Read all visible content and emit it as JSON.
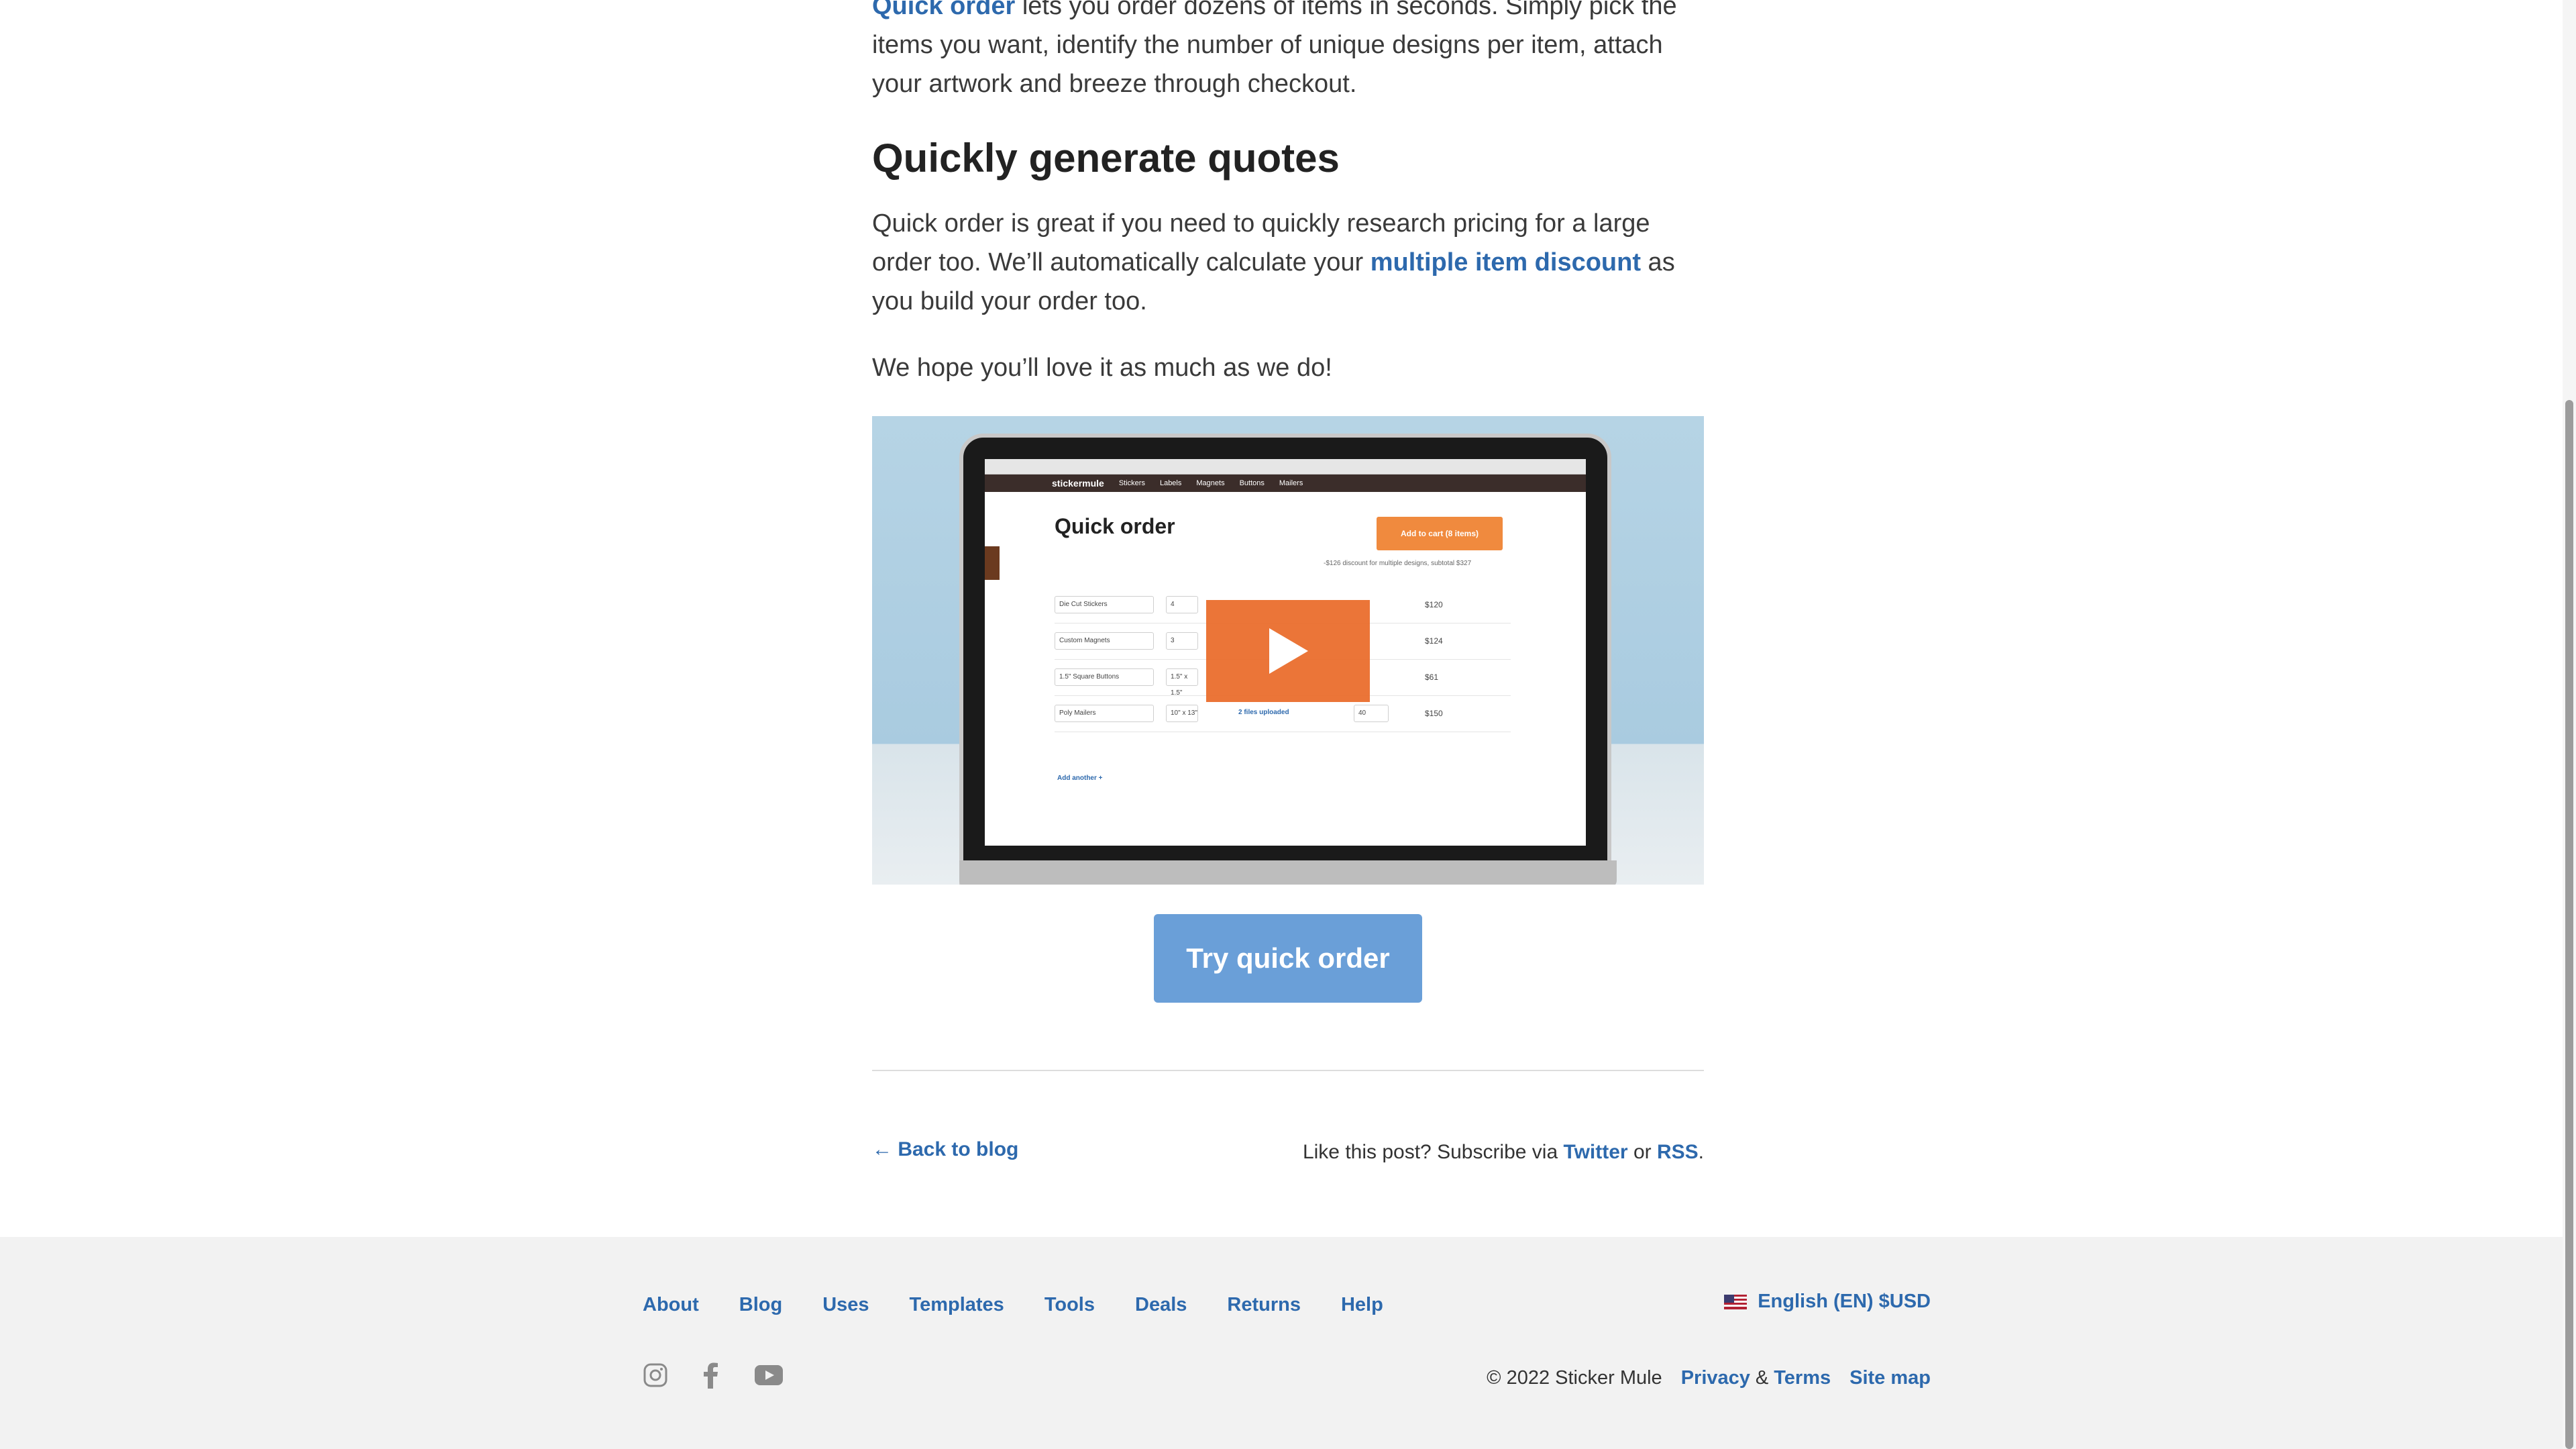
{
  "article": {
    "intro_link": "Quick order",
    "intro_text": " lets you order dozens of items in seconds. Simply pick the items you want, identify the number of unique designs per item, attach your artwork and breeze through checkout.",
    "quotes_heading": "Quickly generate quotes",
    "quotes_text_1": "Quick order is great if you need to quickly research pricing for a large order too. We’ll automatically calculate your ",
    "quotes_link": "multiple item discount",
    "quotes_text_2": " as you build your order too.",
    "hope_text": "We hope you’ll love it as much as we do!"
  },
  "video": {
    "site_logo": "stickermule",
    "nav_items": [
      "Stickers",
      "Labels",
      "Magnets",
      "Buttons",
      "Mailers"
    ],
    "screen_title": "Quick order",
    "cart_button": "Add to cart (8 items)",
    "discount_note": "-$126 discount for multiple designs, subtotal $327",
    "rows": [
      {
        "product": "Die Cut Stickers",
        "size": "4",
        "qty": "",
        "price": "$120",
        "uploaded": ""
      },
      {
        "product": "Custom Magnets",
        "size": "3",
        "qty": "",
        "price": "$124",
        "uploaded": ""
      },
      {
        "product": "1.5\" Square Buttons",
        "size": "1.5\" x 1.5\"",
        "qty": "",
        "price": "$61",
        "uploaded": ""
      },
      {
        "product": "Poly Mailers",
        "size": "10\" x 13\"",
        "qty": "40",
        "price": "$150",
        "uploaded": "2 files uploaded"
      }
    ],
    "add_another": "Add another +"
  },
  "cta": {
    "label": "Try quick order"
  },
  "post_footer": {
    "back_link": "← Back to blog",
    "subscribe_prefix": "Like this post? Subscribe via ",
    "twitter": "Twitter",
    "or": " or ",
    "rss": "RSS",
    "period": "."
  },
  "footer": {
    "nav": [
      "About",
      "Blog",
      "Uses",
      "Templates",
      "Tools",
      "Deals",
      "Returns",
      "Help"
    ],
    "language": "English (EN) $USD",
    "social_icons": [
      "instagram-icon",
      "facebook-icon",
      "youtube-icon"
    ],
    "copyright": "© 2022 Sticker Mule",
    "privacy": "Privacy",
    "amp": "&",
    "terms": "Terms",
    "site_map": "Site map"
  },
  "colors": {
    "link": "#2d69ad",
    "cta": "#6a9fd8",
    "play": "#ea6e2d",
    "footer_bg": "#f2f2f2"
  }
}
